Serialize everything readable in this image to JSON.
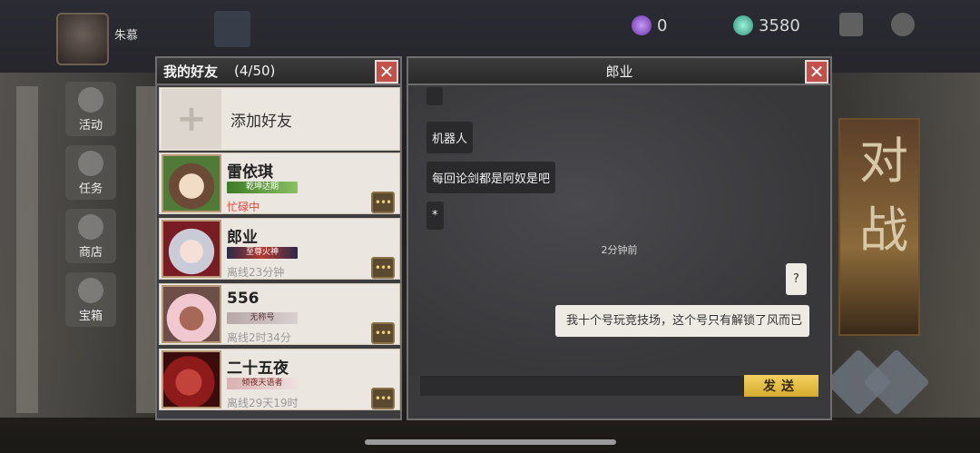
{
  "top": {
    "player_name": "朱慕",
    "resources": [
      {
        "icon": "purple-gem-icon",
        "value": "0"
      },
      {
        "icon": "jade-icon",
        "value": "3580"
      }
    ]
  },
  "side_menu": [
    "活动",
    "任务",
    "商店",
    "宝箱"
  ],
  "duel": {
    "label": "对战"
  },
  "friends_panel": {
    "title": "我的好友",
    "count": "(4/50)",
    "close_icon": "✕",
    "add_friend": {
      "icon": "+",
      "label": "添加好友"
    },
    "friends": [
      {
        "name": "雷依琪",
        "title": "乾坤达期",
        "status": "忙碌中",
        "status_color": "#e0453c",
        "title_style": "tag-green",
        "pic": "pic-1"
      },
      {
        "name": "郎业",
        "title": "至尊火神",
        "status": "离线23分钟",
        "status_color": "#9a9a9a",
        "title_style": "tag-red",
        "pic": "pic-2"
      },
      {
        "name": "556",
        "title": "无称号",
        "status": "离线2时34分",
        "status_color": "#9a9a9a",
        "title_style": "tag-grey",
        "pic": "pic-3"
      },
      {
        "name": "二十五夜",
        "title": "倾夜天语者",
        "status": "离线29天19时",
        "status_color": "#9a9a9a",
        "title_style": "tag-pink",
        "pic": "pic-4"
      }
    ],
    "msg_icon": "•••"
  },
  "chat_panel": {
    "title": "郎业",
    "close_icon": "✕",
    "messages_left": [
      "机器人",
      "每回论剑都是阿奴是吧",
      "*"
    ],
    "time_separator": "2分钟前",
    "messages_right": [
      "?",
      "我十个号玩竞技场，这个号只有解锁了风而已"
    ],
    "send_label": "发送"
  }
}
